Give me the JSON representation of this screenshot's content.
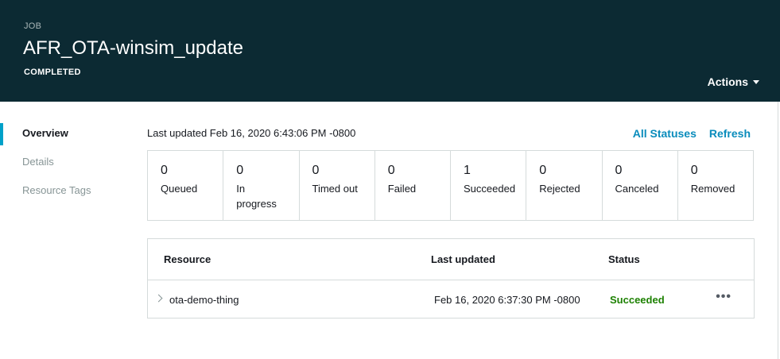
{
  "header": {
    "eyebrow": "JOB",
    "title": "AFR_OTA-winsim_update",
    "status": "COMPLETED",
    "actions_label": "Actions"
  },
  "sidebar": {
    "items": [
      {
        "label": "Overview",
        "active": true
      },
      {
        "label": "Details",
        "active": false
      },
      {
        "label": "Resource Tags",
        "active": false
      }
    ]
  },
  "main": {
    "last_updated": "Last updated Feb 16, 2020 6:43:06 PM -0800",
    "all_statuses_label": "All Statuses",
    "refresh_label": "Refresh",
    "counts": [
      {
        "value": "0",
        "label": "Queued"
      },
      {
        "value": "0",
        "label": "In progress"
      },
      {
        "value": "0",
        "label": "Timed out"
      },
      {
        "value": "0",
        "label": "Failed"
      },
      {
        "value": "1",
        "label": "Succeeded"
      },
      {
        "value": "0",
        "label": "Rejected"
      },
      {
        "value": "0",
        "label": "Canceled"
      },
      {
        "value": "0",
        "label": "Removed"
      }
    ],
    "table": {
      "columns": [
        "Resource",
        "Last updated",
        "Status"
      ],
      "rows": [
        {
          "resource": "ota-demo-thing",
          "last_updated": "Feb 16, 2020 6:37:30 PM -0800",
          "status": "Succeeded",
          "more": "•••"
        }
      ]
    }
  },
  "colors": {
    "header_bg": "#0c2a33",
    "accent": "#00a1c9",
    "link": "#0a8cbc",
    "success": "#1d8102"
  }
}
